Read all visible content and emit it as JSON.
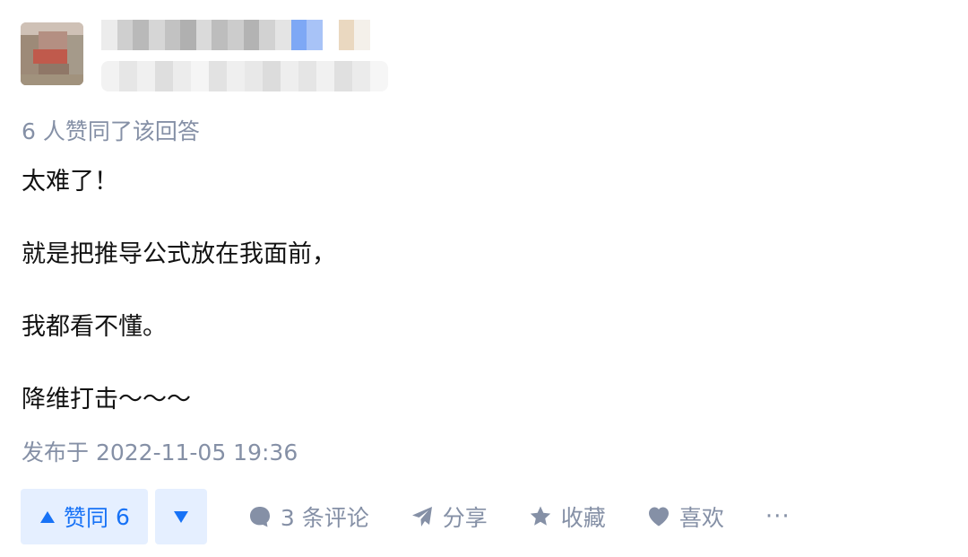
{
  "vote_summary": "6 人赞同了该回答",
  "content": {
    "paragraphs": [
      "太难了！",
      "就是把推导公式放在我面前，",
      "我都看不懂。",
      "降维打击～～～"
    ]
  },
  "publish_time": "发布于 2022-11-05 19:36",
  "actions": {
    "vote_up_label": "赞同",
    "vote_up_count": "6",
    "comment_label": "3 条评论",
    "share_label": "分享",
    "collect_label": "收藏",
    "like_label": "喜欢",
    "more_label": "···"
  },
  "colors": {
    "accent": "#1772f6",
    "accent_bg": "#e5efff",
    "muted": "#8590a6",
    "text": "#121212"
  }
}
